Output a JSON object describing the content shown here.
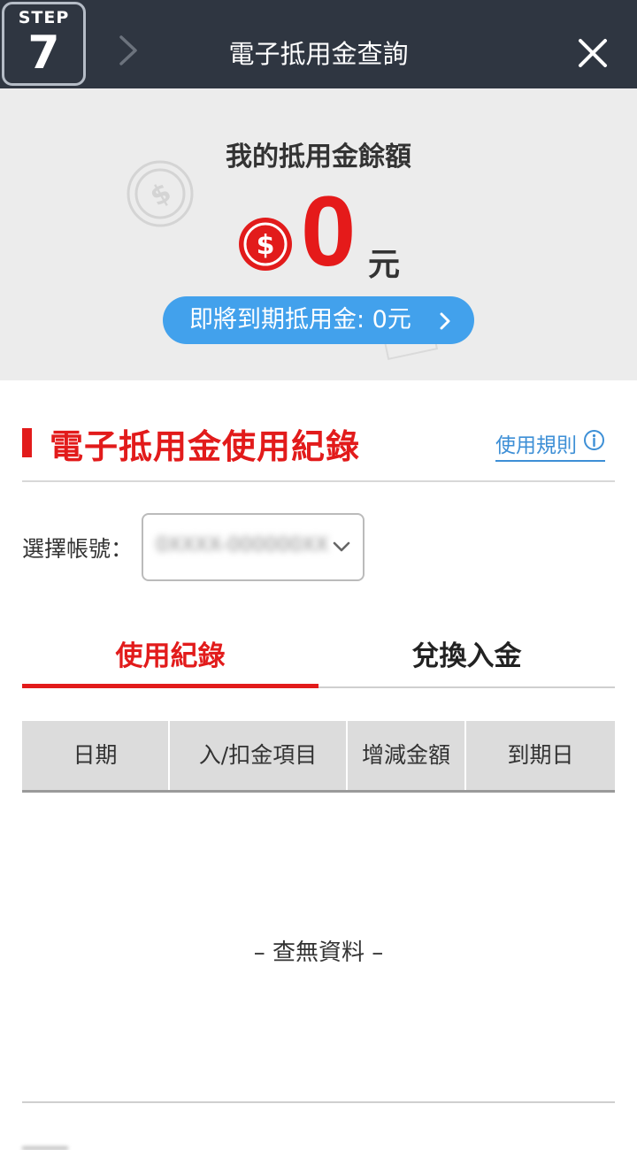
{
  "header": {
    "step_label": "STEP",
    "step_number": "7",
    "title": "電子抵用金查詢"
  },
  "balance": {
    "title": "我的抵用金餘額",
    "amount": "0",
    "unit": "元",
    "expiring_label": "即將到期抵用金: 0元"
  },
  "records": {
    "title": "電子抵用金使用紀錄",
    "rules_link": "使用規則",
    "account_label": "選擇帳號：",
    "account_value": "0XXXX-000000XX",
    "tabs": [
      {
        "label": "使用紀錄",
        "active": true
      },
      {
        "label": "兌換入金",
        "active": false
      }
    ],
    "columns": [
      "日期",
      "入/扣金項目",
      "增減金額",
      "到期日"
    ],
    "empty_text": "– 查無資料 –"
  },
  "colors": {
    "header_bg": "#2f3641",
    "accent_red": "#e21b1b",
    "link_blue": "#3d8fd6",
    "pill_blue": "#42a1ec",
    "panel_gray": "#ececec"
  },
  "icons": [
    "back-chevron-icon",
    "close-icon",
    "coin-decoration-icon",
    "dollar-coin-icon",
    "chevron-right-icon",
    "info-icon",
    "chevron-down-icon"
  ]
}
